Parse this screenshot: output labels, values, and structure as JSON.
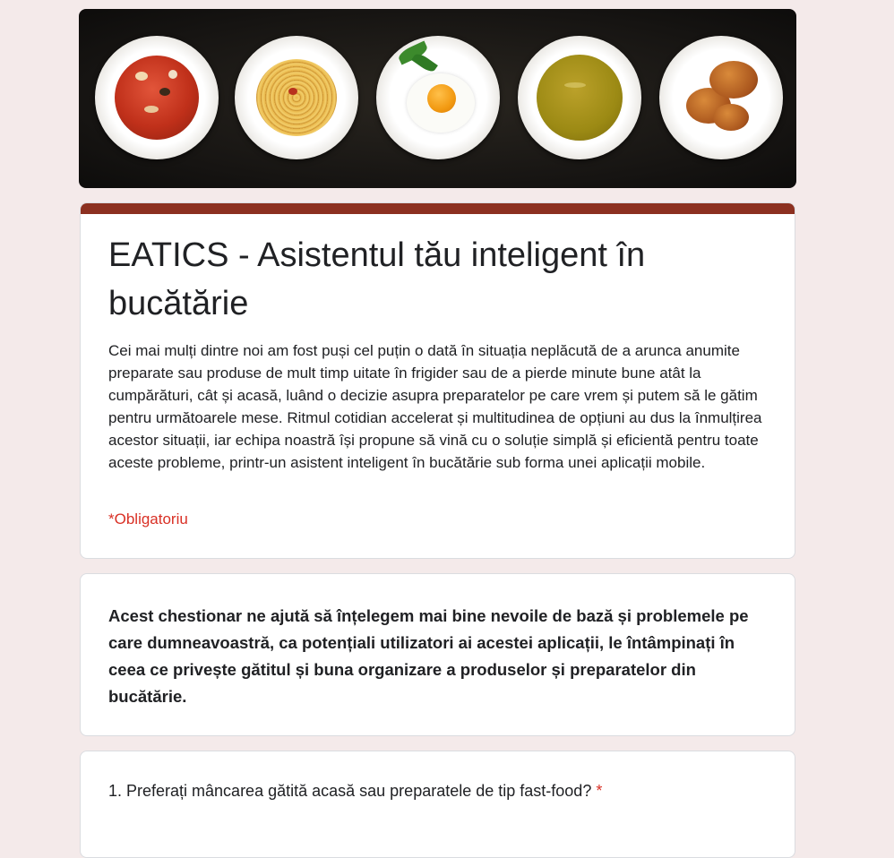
{
  "header": {
    "banner_alt": "food-plates-banner",
    "plates": [
      "tomato-soup",
      "spaghetti",
      "fried-egg",
      "pea-soup",
      "croissants"
    ]
  },
  "form": {
    "title": "EATICS - Asistentul tău inteligent în bucătărie",
    "description": "Cei mai mulți dintre noi am fost puși cel puțin o dată în situația neplăcută de a arunca anumite preparate sau produse de mult timp uitate în frigider sau de a pierde minute bune atât la cumpărături, cât și acasă, luând o decizie asupra preparatelor pe care vrem și putem să le gătim pentru următoarele mese. Ritmul cotidian accelerat și multitudinea de opțiuni au dus la înmulțirea acestor situații, iar echipa noastră își propune să vină cu o soluție simplă și eficientă pentru toate aceste probleme, printr-un asistent inteligent în bucătărie sub forma unei aplicații mobile.",
    "required_note": "*Obligatoriu"
  },
  "section": {
    "text": "Acest chestionar ne ajută să înțelegem mai bine nevoile de bază și problemele pe care dumneavoastră, ca potențiali utilizatori ai acestei aplicații, le întâmpinați în ceea ce privește gătitul și buna organizare a produselor și preparatelor din bucătărie."
  },
  "question": {
    "text": "1. Preferați mâncarea gătită acasă sau preparatele de tip fast-food?",
    "required_mark": "*"
  },
  "colors": {
    "page_bg": "#f4eaea",
    "accent": "#8c3020",
    "required": "#d93025"
  }
}
